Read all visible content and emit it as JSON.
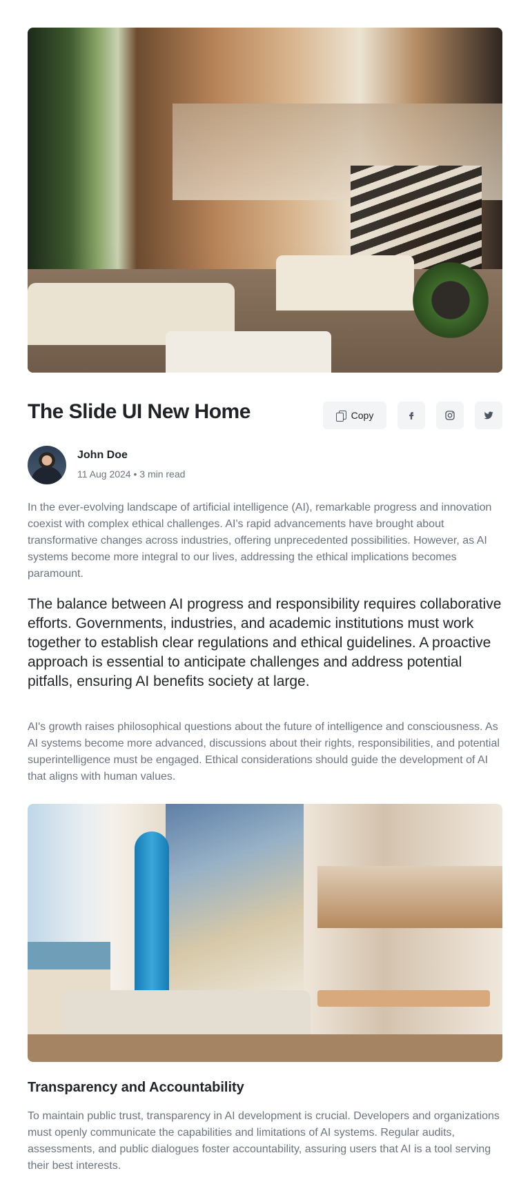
{
  "article": {
    "title": "The Slide UI New Home",
    "hero_image_alt": "",
    "actions": {
      "copy_label": "Copy",
      "social": [
        "f",
        "instagram",
        "twitter"
      ]
    },
    "author": {
      "name": "John Doe",
      "meta": "11 Aug 2024 • 3 min read"
    },
    "paragraphs": {
      "intro": "In the ever-evolving landscape of artificial intelligence (AI), remarkable progress and innovation coexist with complex ethical challenges. AI's rapid advancements have brought about transformative changes across industries, offering unprecedented possibilities. However, as AI systems become more integral to our lives, addressing the ethical implications becomes paramount.",
      "lead": "The balance between AI progress and responsibility requires collaborative efforts. Governments, industries, and academic institutions must work together to establish clear regulations and ethical guidelines. A proactive approach is essential to anticipate challenges and address potential pitfalls, ensuring AI benefits society at large.",
      "growth": "AI's growth raises philosophical questions about the future of intelligence and consciousness. As AI systems become more advanced, discussions about their rights, responsibilities, and potential superintelligence must be engaged. Ethical considerations should guide the development of AI that aligns with human values."
    },
    "section": {
      "heading": "Transparency and Accountability",
      "body": "To maintain public trust, transparency in AI development is crucial. Developers and organizations must openly communicate the capabilities and limitations of AI systems. Regular audits, assessments, and public dialogues foster accountability, assuring users that AI is a tool serving their best interests."
    }
  },
  "icons": {
    "copy": "copy-icon",
    "facebook": "facebook-icon",
    "instagram": "instagram-icon",
    "twitter": "twitter-icon"
  }
}
